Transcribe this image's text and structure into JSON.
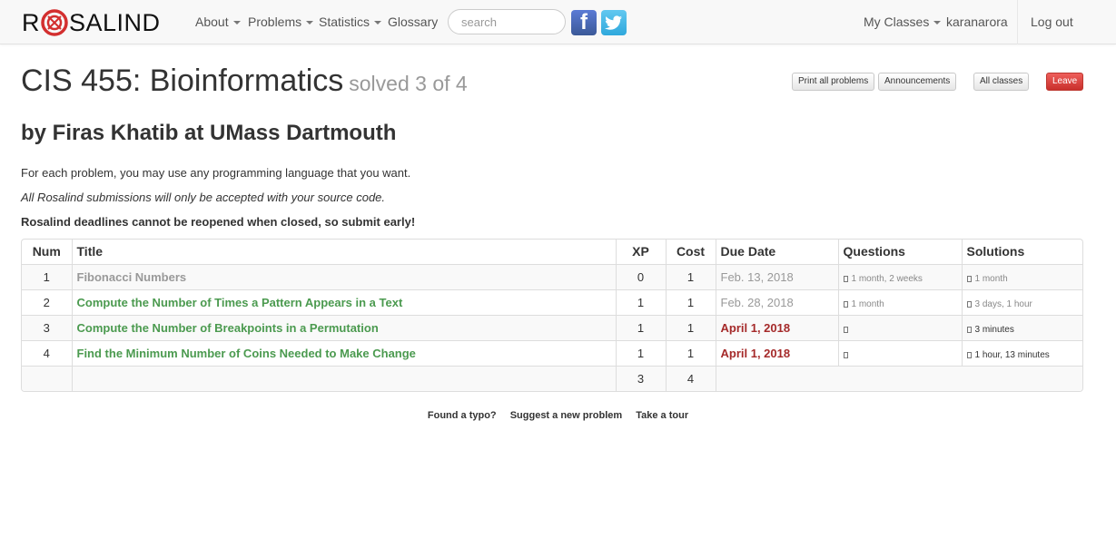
{
  "navbar": {
    "brand_left": "R",
    "brand_right": "SALIND",
    "items": [
      {
        "label": "About"
      },
      {
        "label": "Problems"
      },
      {
        "label": "Statistics"
      },
      {
        "label": "Glossary"
      }
    ],
    "search_placeholder": "search",
    "facebook_glyph": "f",
    "my_classes": "My Classes",
    "username": "karanarora",
    "logout": "Log out"
  },
  "header": {
    "title": "CIS 455: Bioinformatics",
    "solved": "solved 3 of 4",
    "subtitle": "by Firas Khatib at UMass Dartmouth"
  },
  "buttons": {
    "print_all": "Print all problems",
    "announcements": "Announcements",
    "all_classes": "All classes",
    "leave": "Leave"
  },
  "intro": {
    "line1": "For each problem, you may use any programming language that you want.",
    "line2": "All Rosalind submissions will only be accepted with your source code.",
    "line3": "Rosalind deadlines cannot be reopened when closed, so submit early!"
  },
  "table": {
    "headers": {
      "num": "Num",
      "title": "Title",
      "xp": "XP",
      "cost": "Cost",
      "due": "Due Date",
      "questions": "Questions",
      "solutions": "Solutions"
    },
    "rows": [
      {
        "num": "1",
        "title": "Fibonacci Numbers",
        "xp": "0",
        "cost": "1",
        "due": "Feb. 13, 2018",
        "questions": "1 month, 2 weeks",
        "solutions": "1 month"
      },
      {
        "num": "2",
        "title": "Compute the Number of Times a Pattern Appears in a Text",
        "xp": "1",
        "cost": "1",
        "due": "Feb. 28, 2018",
        "questions": "1 month",
        "solutions": "3 days, 1 hour"
      },
      {
        "num": "3",
        "title": "Compute the Number of Breakpoints in a Permutation",
        "xp": "1",
        "cost": "1",
        "due": "April 1, 2018",
        "questions": "",
        "solutions": "3 minutes"
      },
      {
        "num": "4",
        "title": "Find the Minimum Number of Coins Needed to Make Change",
        "xp": "1",
        "cost": "1",
        "due": "April 1, 2018",
        "questions": "",
        "solutions": "1 hour, 13 minutes"
      }
    ],
    "totals": {
      "xp": "3",
      "cost": "4"
    }
  },
  "footer": {
    "typo": "Found a typo?",
    "suggest": "Suggest a new problem",
    "tour": "Take a tour"
  },
  "colors": {
    "accent_green": "#4b9a4f",
    "due_red": "#a52a2a",
    "leave_red": "#d9534f",
    "logo_red": "#d32f2f"
  }
}
